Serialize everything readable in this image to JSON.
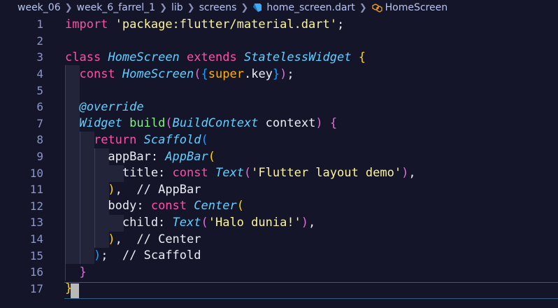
{
  "breadcrumb": {
    "items": [
      "week_06",
      "week_6_farrel_1",
      "lib",
      "screens",
      "home_screen.dart",
      "HomeScreen"
    ]
  },
  "editor": {
    "line_numbers": [
      "1",
      "2",
      "3",
      "4",
      "5",
      "6",
      "7",
      "8",
      "9",
      "10",
      "11",
      "12",
      "13",
      "14",
      "15",
      "16",
      "17"
    ],
    "lines": [
      [
        [
          "kw",
          "import"
        ],
        [
          "plain",
          " "
        ],
        [
          "str",
          "'package:flutter/material.dart'"
        ],
        [
          "plain",
          ";"
        ]
      ],
      [],
      [
        [
          "kw",
          "class"
        ],
        [
          "plain",
          " "
        ],
        [
          "cls",
          "HomeScreen"
        ],
        [
          "plain",
          " "
        ],
        [
          "kw",
          "extends"
        ],
        [
          "plain",
          " "
        ],
        [
          "cls",
          "StatelessWidget"
        ],
        [
          "plain",
          " "
        ],
        [
          "br1",
          "{"
        ]
      ],
      [
        [
          "plain",
          "  "
        ],
        [
          "kw",
          "const"
        ],
        [
          "plain",
          " "
        ],
        [
          "cls",
          "HomeScreen"
        ],
        [
          "br2",
          "("
        ],
        [
          "br3",
          "{"
        ],
        [
          "sup",
          "super"
        ],
        [
          "plain",
          ".key"
        ],
        [
          "br3",
          "}"
        ],
        [
          "br2",
          ")"
        ],
        [
          "plain",
          ";"
        ]
      ],
      [],
      [
        [
          "plain",
          "  "
        ],
        [
          "ann",
          "@override"
        ]
      ],
      [
        [
          "plain",
          "  "
        ],
        [
          "cls",
          "Widget"
        ],
        [
          "plain",
          " "
        ],
        [
          "fn",
          "build"
        ],
        [
          "br2",
          "("
        ],
        [
          "cls",
          "BuildContext"
        ],
        [
          "plain",
          " context"
        ],
        [
          "br2",
          ")"
        ],
        [
          "plain",
          " "
        ],
        [
          "br2",
          "{"
        ]
      ],
      [
        [
          "plain",
          "    "
        ],
        [
          "kw",
          "return"
        ],
        [
          "plain",
          " "
        ],
        [
          "cls",
          "Scaffold"
        ],
        [
          "br3",
          "("
        ]
      ],
      [
        [
          "plain",
          "      appBar: "
        ],
        [
          "cls",
          "AppBar"
        ],
        [
          "br1",
          "("
        ]
      ],
      [
        [
          "plain",
          "        title: "
        ],
        [
          "kw",
          "const"
        ],
        [
          "plain",
          " "
        ],
        [
          "cls",
          "Text"
        ],
        [
          "br2",
          "("
        ],
        [
          "str",
          "'Flutter layout demo'"
        ],
        [
          "br2",
          ")"
        ],
        [
          "plain",
          ","
        ]
      ],
      [
        [
          "plain",
          "      "
        ],
        [
          "br1",
          ")"
        ],
        [
          "plain",
          ",  // AppBar"
        ]
      ],
      [
        [
          "plain",
          "      body: "
        ],
        [
          "kw",
          "const"
        ],
        [
          "plain",
          " "
        ],
        [
          "cls",
          "Center"
        ],
        [
          "br1",
          "("
        ]
      ],
      [
        [
          "plain",
          "        child: "
        ],
        [
          "cls",
          "Text"
        ],
        [
          "br2",
          "("
        ],
        [
          "str",
          "'Halo dunia!'"
        ],
        [
          "br2",
          ")"
        ],
        [
          "plain",
          ","
        ]
      ],
      [
        [
          "plain",
          "      "
        ],
        [
          "br1",
          ")"
        ],
        [
          "plain",
          ",  // Center"
        ]
      ],
      [
        [
          "plain",
          "    "
        ],
        [
          "br3",
          ")"
        ],
        [
          "plain",
          ";  // Scaffold"
        ]
      ],
      [
        [
          "plain",
          "  "
        ],
        [
          "br2",
          "}"
        ]
      ],
      [
        [
          "br1",
          "}"
        ]
      ]
    ]
  },
  "colors": {
    "background": "#15152a",
    "keyword": "#ff4fa8",
    "type": "#5fd0ff",
    "string": "#fbf49a",
    "function": "#7ff27f",
    "line_number": "#8a96c8"
  }
}
